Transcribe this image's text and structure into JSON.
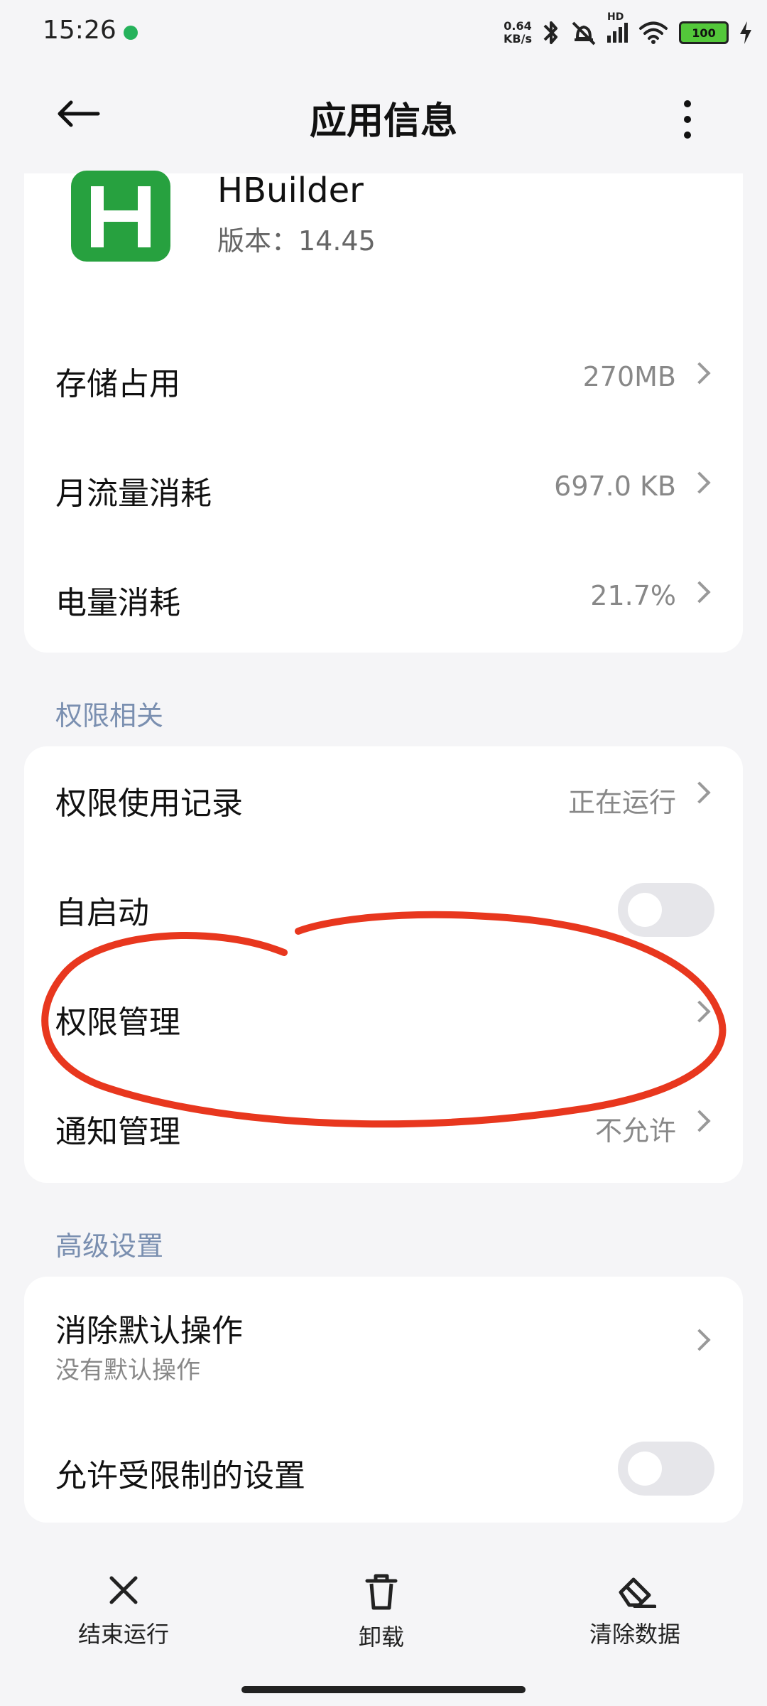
{
  "status_bar": {
    "time": "15:26",
    "net_speed_value": "0.64",
    "net_speed_unit": "KB/s",
    "network_tag": "HD",
    "battery": "100",
    "icons": [
      "android-icon",
      "bluetooth-icon",
      "silent-bell-icon",
      "signal-icon",
      "wifi-icon",
      "battery-icon",
      "charging-icon"
    ]
  },
  "header": {
    "title": "应用信息",
    "back_icon": "back-arrow-icon",
    "more_icon": "more-vertical-icon"
  },
  "app": {
    "name": "HBuilder",
    "version_label": "版本：14.45",
    "icon_letter": "H",
    "icon_color": "#27a13f"
  },
  "app_stats": [
    {
      "label": "存储占用",
      "value": "270MB"
    },
    {
      "label": "月流量消耗",
      "value": "697.0 KB"
    },
    {
      "label": "电量消耗",
      "value": "21.7%"
    }
  ],
  "permissions_section": {
    "title": "权限相关",
    "items": [
      {
        "label": "权限使用记录",
        "value": "正在运行"
      },
      {
        "label": "自启动",
        "toggle": false
      },
      {
        "label": "权限管理",
        "value": ""
      },
      {
        "label": "通知管理",
        "value": "不允许"
      }
    ]
  },
  "advanced_section": {
    "title": "高级设置",
    "items": [
      {
        "label": "消除默认操作",
        "subtext": "没有默认操作"
      },
      {
        "label": "允许受限制的设置",
        "toggle": false
      }
    ]
  },
  "bottom_bar": {
    "actions": [
      {
        "label": "结束运行",
        "icon": "close-icon"
      },
      {
        "label": "卸载",
        "icon": "trash-icon"
      },
      {
        "label": "清除数据",
        "icon": "eraser-icon"
      }
    ]
  },
  "colors": {
    "accent": "#27a13f",
    "annotation": "#e8371e",
    "section_text": "#7a8fb0"
  }
}
